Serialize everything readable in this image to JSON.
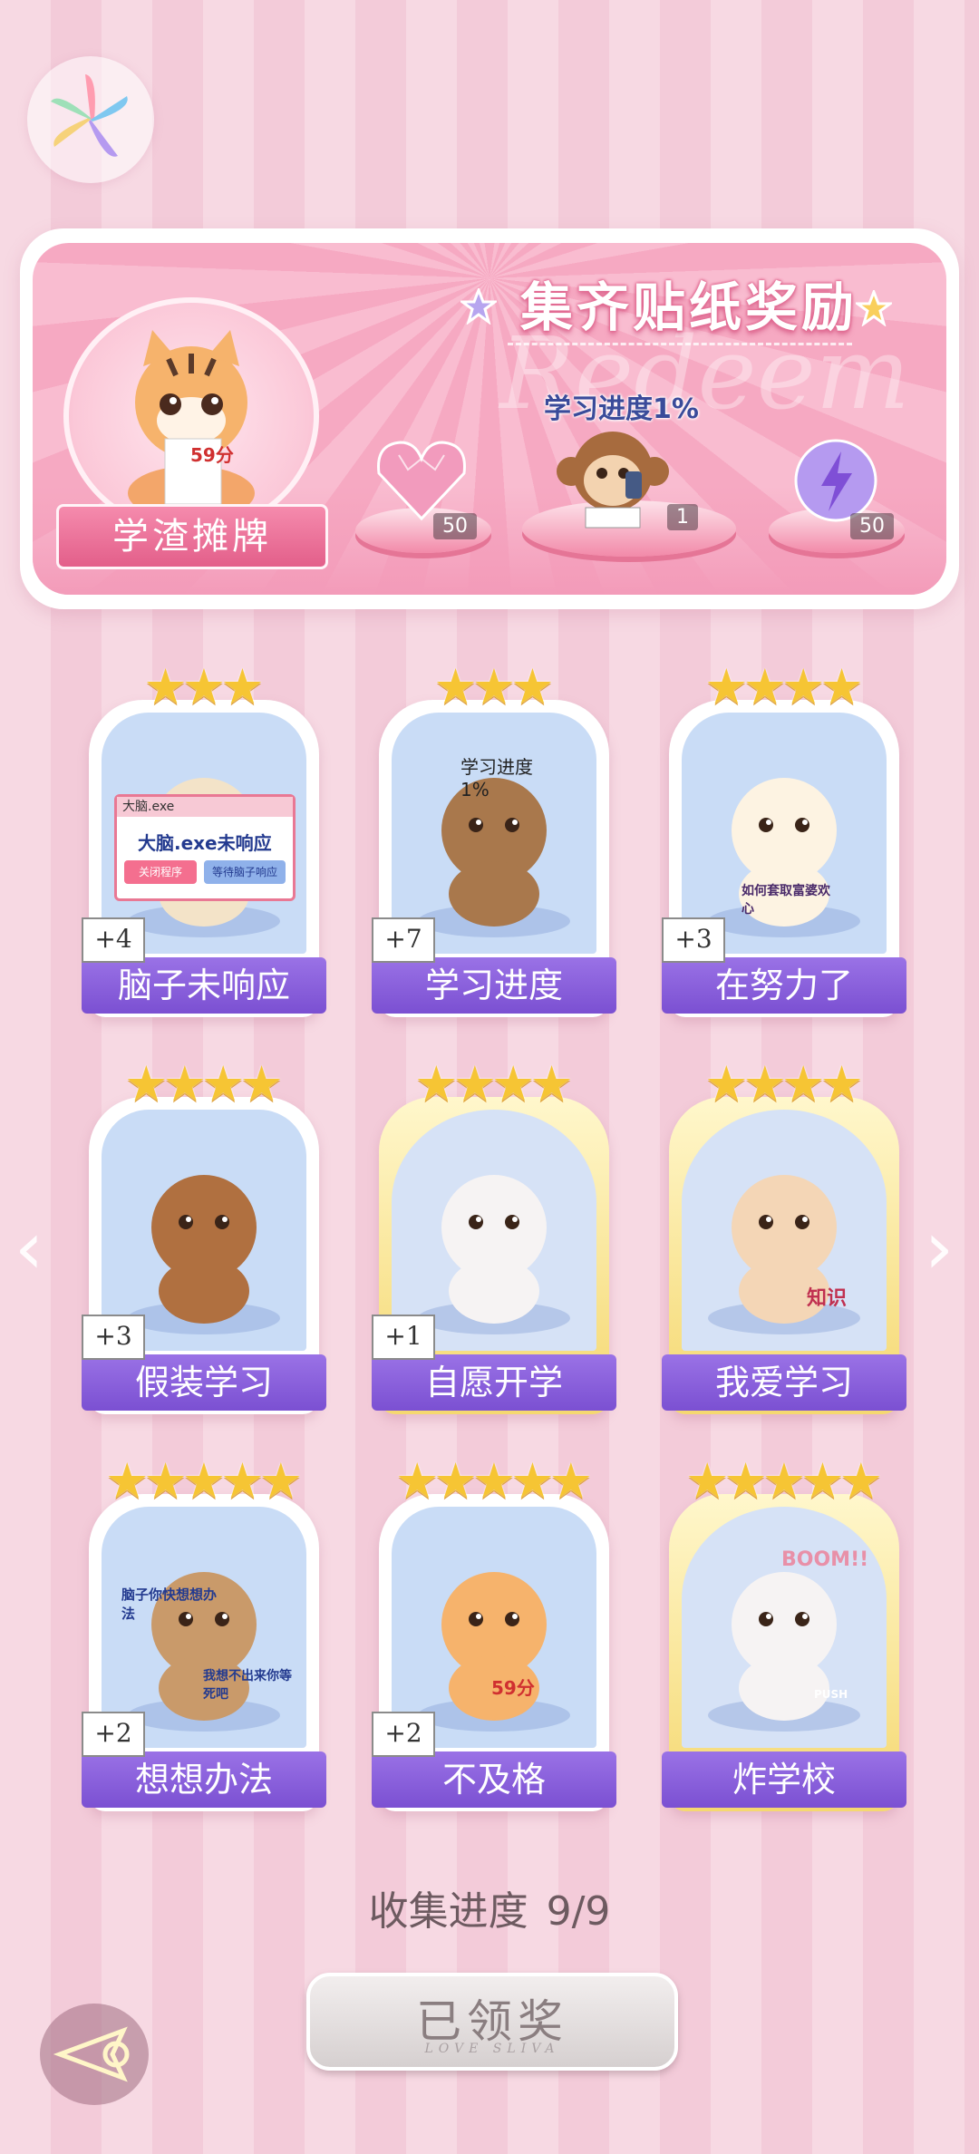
{
  "app": {
    "logo_icon": "pinwheel-logo-icon"
  },
  "banner": {
    "title": "集齐贴纸奖励",
    "watermark": "Redeem",
    "featured_sticker": "学渣摊牌",
    "featured_score": "59分",
    "progress_label": "学习进度1%",
    "rewards": [
      {
        "icon": "pink-heart-gem-icon",
        "count": "50"
      },
      {
        "icon": "monkey-phone-sticker-icon",
        "count": "1"
      },
      {
        "icon": "purple-lightning-orb-icon",
        "count": "50"
      }
    ]
  },
  "cards": [
    {
      "label": "脑子未响应",
      "badge": "+4",
      "stars": 3,
      "gold": false,
      "art": {
        "title": "大脑.exe",
        "text": "大脑.exe未响应",
        "btn1": "关闭程序",
        "btn2": "等待脑子响应",
        "icon": "computer-dialog-icon"
      }
    },
    {
      "label": "学习进度",
      "badge": "+7",
      "stars": 3,
      "gold": false,
      "art": {
        "text": "学习进度1%",
        "icon": "sloth-sleeping-icon"
      }
    },
    {
      "label": "在努力了",
      "badge": "+3",
      "stars": 4,
      "gold": false,
      "art": {
        "text": "如何套取富婆欢心",
        "icon": "puppy-reading-icon"
      }
    },
    {
      "label": "假装学习",
      "badge": "+3",
      "stars": 4,
      "gold": false,
      "art": {
        "icon": "monkey-reading-icon"
      }
    },
    {
      "label": "自愿开学",
      "badge": "+1",
      "stars": 4,
      "gold": true,
      "art": {
        "icon": "bunny-handcuffed-icon"
      }
    },
    {
      "label": "我爱学习",
      "badge": "",
      "stars": 4,
      "gold": true,
      "art": {
        "text": "知识",
        "icon": "angel-cat-icon"
      }
    },
    {
      "label": "想想办法",
      "badge": "+2",
      "stars": 5,
      "gold": false,
      "art": {
        "text": "脑子你快想想办法",
        "text2": "我想不出来你等死吧",
        "icon": "bear-brain-icon"
      }
    },
    {
      "label": "不及格",
      "badge": "+2",
      "stars": 5,
      "gold": false,
      "art": {
        "text": "59分",
        "icon": "tiger-test-icon"
      }
    },
    {
      "label": "炸学校",
      "badge": "",
      "stars": 5,
      "gold": true,
      "art": {
        "text": "BOOM!!",
        "text2": "PUSH",
        "icon": "bunny-detonator-icon"
      }
    }
  ],
  "progress": {
    "label": "收集进度",
    "value": "9/9"
  },
  "claim_button": {
    "label": "已领奖",
    "sub": "LOVE SLIVA"
  },
  "colors": {
    "card_label": "#8a5fdc",
    "panel": "#f6a9c2",
    "star": "#f6c534"
  }
}
